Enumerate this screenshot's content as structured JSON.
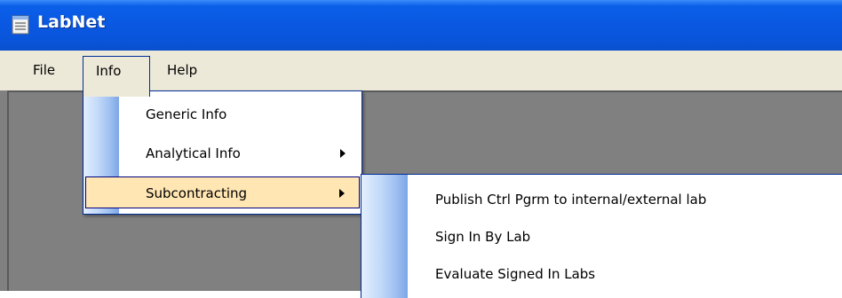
{
  "window": {
    "title": "LabNet",
    "icon": "app-window-icon"
  },
  "menubar": {
    "items": [
      {
        "label": "File"
      },
      {
        "label": "Info"
      },
      {
        "label": "Help"
      }
    ]
  },
  "info_menu": {
    "items": [
      {
        "label": "Generic Info",
        "has_submenu": false
      },
      {
        "label": "Analytical Info",
        "has_submenu": true
      },
      {
        "label": "Subcontracting",
        "has_submenu": true,
        "highlighted": true
      }
    ]
  },
  "subcontracting_menu": {
    "items": [
      {
        "label": "Publish Ctrl Pgrm to internal/external lab"
      },
      {
        "label": "Sign In By Lab"
      },
      {
        "label": "Evaluate Signed In Labs"
      }
    ]
  },
  "colors": {
    "titlebar": "#0a58e2",
    "menubar": "#ece9d8",
    "workspace": "#808080",
    "highlight": "#ffe6b3",
    "border": "#002d96"
  }
}
